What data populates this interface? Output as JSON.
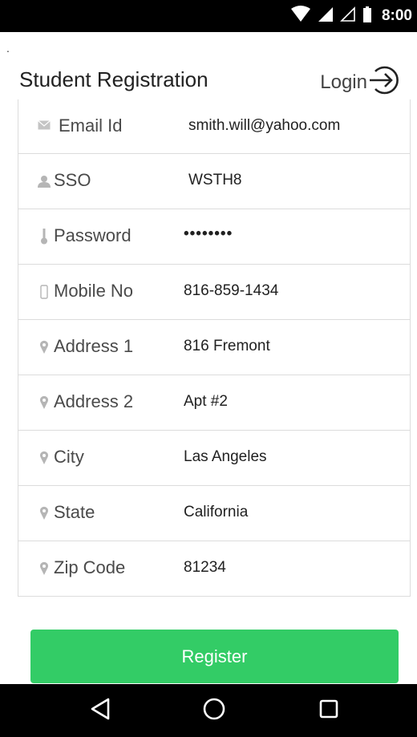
{
  "status_bar": {
    "time": "8:00",
    "icons": [
      "wifi-icon",
      "signal-icon",
      "signal-empty-icon",
      "battery-icon"
    ]
  },
  "header": {
    "dot": ".",
    "title": "Student Registration",
    "login_label": "Login",
    "login_icon": "arrow-right-circle-icon"
  },
  "form": {
    "rows": [
      {
        "icon": "email-icon",
        "label": "Email Id",
        "value": "smith.will@yahoo.com"
      },
      {
        "icon": "person-icon",
        "label": "SSO",
        "value": "WSTH8"
      },
      {
        "icon": "key-icon",
        "label": "Password",
        "value": "••••••••"
      },
      {
        "icon": "mobile-icon",
        "label": "Mobile No",
        "value": "816-859-1434"
      },
      {
        "icon": "location-icon",
        "label": "Address 1",
        "value": "816 Fremont"
      },
      {
        "icon": "location-icon",
        "label": "Address 2",
        "value": "Apt #2"
      },
      {
        "icon": "location-icon",
        "label": "City",
        "value": "Las Angeles"
      },
      {
        "icon": "location-icon",
        "label": "State",
        "value": "California"
      },
      {
        "icon": "location-icon",
        "label": "Zip Code",
        "value": "81234"
      }
    ]
  },
  "register_label": "Register",
  "nav_bar": {
    "icons": [
      "back-icon",
      "home-icon",
      "recents-icon"
    ]
  },
  "colors": {
    "accent": "#33cc66",
    "bar": "#000000",
    "divider": "#dcdcdc",
    "icon": "#b5b5b5"
  }
}
